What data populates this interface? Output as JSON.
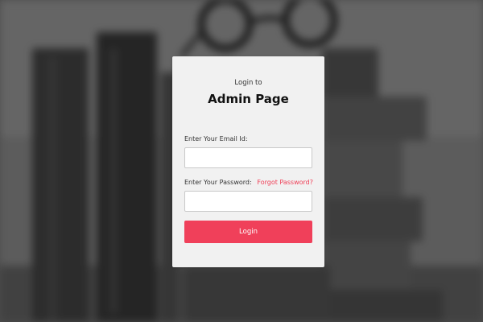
{
  "login": {
    "subtitle": "Login to",
    "title": "Admin Page",
    "email_label": "Enter Your Email Id:",
    "email_value": "",
    "password_label": "Enter Your Password:",
    "password_value": "",
    "forgot_password": "Forgot Password?",
    "submit_label": "Login"
  },
  "colors": {
    "accent": "#f0405a",
    "card_background": "#f1f1f1",
    "page_background": "#5a5a5a"
  },
  "background": {
    "icons": [
      "books-image",
      "eyeglasses-image"
    ]
  }
}
